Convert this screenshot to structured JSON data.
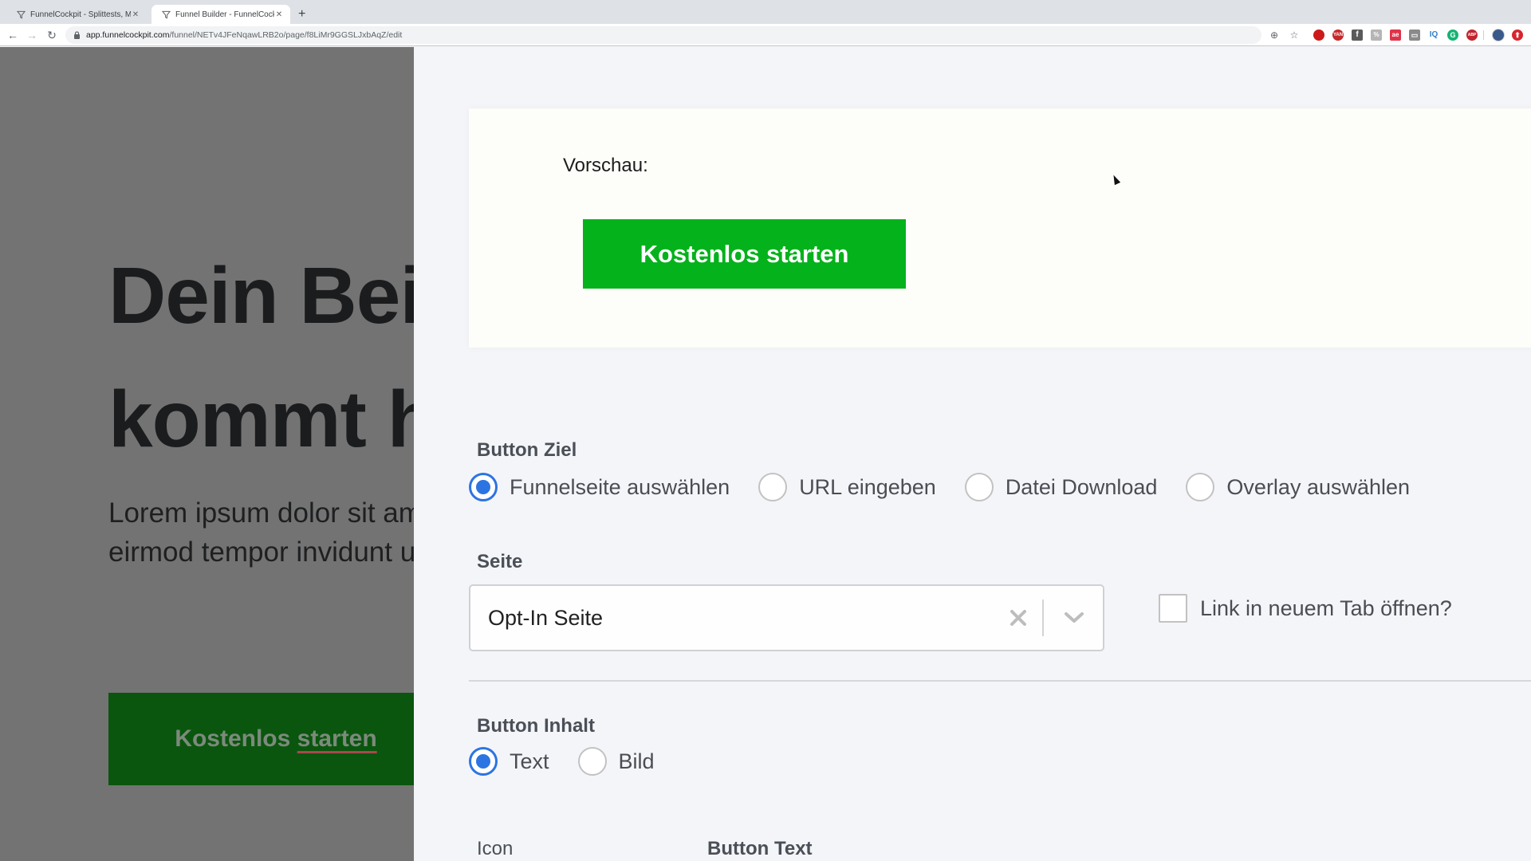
{
  "browser": {
    "tabs": [
      {
        "title": "FunnelCockpit - Splittests, Ma",
        "icon": "funnel-icon",
        "active": false
      },
      {
        "title": "Funnel Builder - FunnelCockpit",
        "icon": "funnel-icon",
        "active": true
      }
    ],
    "new_tab_label": "+",
    "close_label": "✕",
    "url_host": "app.funnelcockpit.com",
    "url_path": "/funnel/NETv4JFeNqawLRB2o/page/f8LiMr9GGSLJxbAqZ/edit",
    "nav": {
      "back": "←",
      "forward": "→",
      "reload": "↻"
    },
    "extensions": [
      {
        "name": "opera-ext-icon",
        "label": "",
        "color": "#cc1a1a"
      },
      {
        "name": "yan-ext-icon",
        "label": "YAN",
        "color": "#c42a2a"
      },
      {
        "name": "facebook-ext-icon",
        "label": "f",
        "color": "#5a5a5a"
      },
      {
        "name": "percent-ext-icon",
        "label": "%",
        "color": "#b5b5b5"
      },
      {
        "name": "ae-ext-icon",
        "label": "ae",
        "color": "#e0334a"
      },
      {
        "name": "screen-ext-icon",
        "label": "▭",
        "color": "#8a8a8a"
      },
      {
        "name": "iq-ext-icon",
        "label": "IQ",
        "color": "#ffffff"
      },
      {
        "name": "grammarly-ext-icon",
        "label": "G",
        "color": "#15b374"
      },
      {
        "name": "adblock-ext-icon",
        "label": "ABP",
        "color": "#c0242e"
      }
    ]
  },
  "background_page": {
    "heading_line1": "Dein Beis",
    "heading_line2": "kommt hi",
    "paragraph_line1": "Lorem ipsum dolor sit am",
    "paragraph_line2": "eirmod tempor invidunt u",
    "button_word1": "Kostenlos",
    "button_word2": "starten"
  },
  "editor": {
    "preview": {
      "label": "Vorschau:",
      "button_text": "Kostenlos starten",
      "button_color": "#04b21b"
    },
    "button_target": {
      "label": "Button Ziel",
      "options": [
        {
          "label": "Funnelseite auswählen",
          "checked": true
        },
        {
          "label": "URL eingeben",
          "checked": false
        },
        {
          "label": "Datei Download",
          "checked": false
        },
        {
          "label": "Overlay auswählen",
          "checked": false
        }
      ]
    },
    "page_select": {
      "label": "Seite",
      "value": "Opt-In Seite"
    },
    "new_tab_checkbox": {
      "label": "Link in neuem Tab öffnen?",
      "checked": false
    },
    "button_content": {
      "label": "Button Inhalt",
      "options": [
        {
          "label": "Text",
          "checked": true
        },
        {
          "label": "Bild",
          "checked": false
        }
      ]
    },
    "icon_label": "Icon",
    "button_text_label": "Button Text",
    "accent_color": "#2c74e2"
  }
}
